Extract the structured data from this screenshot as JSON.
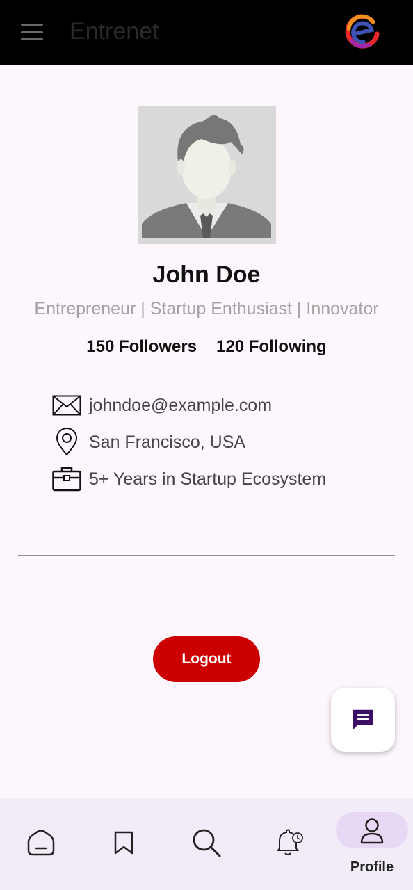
{
  "app": {
    "title": "Entrenet",
    "brand_colors": [
      "#e6282d",
      "#f28f1d",
      "#3f51b5",
      "#9c27b0"
    ]
  },
  "profile": {
    "name": "John Doe",
    "tagline": "Entrepreneur | Startup Enthusiast | Innovator",
    "followers": "150 Followers",
    "following": "120 Following",
    "details": [
      {
        "icon": "envelope-icon",
        "text": "johndoe@example.com"
      },
      {
        "icon": "location-pin-icon",
        "text": "San Francisco, USA"
      },
      {
        "icon": "briefcase-icon",
        "text": "5+ Years in Startup Ecosystem"
      }
    ]
  },
  "actions": {
    "logout_label": "Logout",
    "logout_color": "#cc0000",
    "chat_fab_icon": "chat-message-icon",
    "chat_fab_color": "#3b0f66"
  },
  "bottom_nav": {
    "items": [
      {
        "icon": "home-icon"
      },
      {
        "icon": "bookmark-icon"
      },
      {
        "icon": "search-icon"
      },
      {
        "icon": "notification-bell-icon"
      },
      {
        "icon": "profile-icon",
        "label": "Profile",
        "active": true
      }
    ],
    "active_color": "#e7d9f5"
  }
}
